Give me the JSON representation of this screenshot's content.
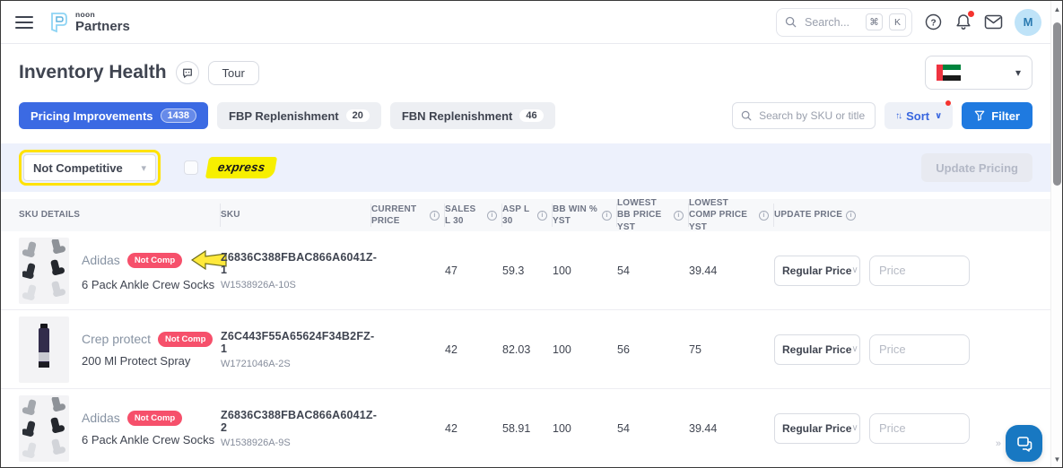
{
  "topbar": {
    "logo": {
      "top": "noon",
      "bottom": "Partners"
    },
    "search_placeholder": "Search...",
    "shortcut_cmd": "⌘",
    "shortcut_k": "K",
    "avatar_initial": "M"
  },
  "page": {
    "title": "Inventory Health",
    "tour_label": "Tour"
  },
  "tabs": [
    {
      "label": "Pricing Improvements",
      "count": "1438"
    },
    {
      "label": "FBP Replenishment",
      "count": "20"
    },
    {
      "label": "FBN Replenishment",
      "count": "46"
    }
  ],
  "toolbar": {
    "search_placeholder": "Search by SKU or title",
    "sort_label": "Sort",
    "filter_label": "Filter"
  },
  "filter_bar": {
    "status_filter": "Not Competitive",
    "express_label": "express",
    "update_pricing_label": "Update Pricing"
  },
  "table": {
    "columns": [
      {
        "label": "SKU DETAILS"
      },
      {
        "label": "SKU"
      },
      {
        "label": "CURRENT PRICE"
      },
      {
        "label": "SALES L 30"
      },
      {
        "label": "ASP L 30"
      },
      {
        "label": "BB WIN % YST"
      },
      {
        "label": "LOWEST BB PRICE YST"
      },
      {
        "label": "LOWEST COMP PRICE YST"
      },
      {
        "label": "UPDATE PRICE"
      }
    ],
    "rows": [
      {
        "brand": "Adidas",
        "badge": "Not Comp",
        "title": "6 Pack Ankle Crew Socks",
        "sku": "Z6836C388FBAC866A6041Z-1",
        "sku_child": "W1538926A-10S",
        "current_price": "",
        "sales_l30": "47",
        "asp_l30": "59.3",
        "bb_win_yst": "100",
        "lowest_bb_price_yst": "54",
        "lowest_comp_price_yst": "39.44",
        "price_type": "Regular Price",
        "price_placeholder": "Price"
      },
      {
        "brand": "Crep protect",
        "badge": "Not Comp",
        "title": "200 Ml Protect Spray",
        "sku": "Z6C443F55A65624F34B2FZ-1",
        "sku_child": "W1721046A-2S",
        "current_price": "",
        "sales_l30": "42",
        "asp_l30": "82.03",
        "bb_win_yst": "100",
        "lowest_bb_price_yst": "56",
        "lowest_comp_price_yst": "75",
        "price_type": "Regular Price",
        "price_placeholder": "Price"
      },
      {
        "brand": "Adidas",
        "badge": "Not Comp",
        "title": "6 Pack Ankle Crew Socks",
        "sku": "Z6836C388FBAC866A6041Z-2",
        "sku_child": "W1538926A-9S",
        "current_price": "",
        "sales_l30": "42",
        "asp_l30": "58.91",
        "bb_win_yst": "100",
        "lowest_bb_price_yst": "54",
        "lowest_comp_price_yst": "39.44",
        "price_type": "Regular Price",
        "price_placeholder": "Price"
      }
    ]
  },
  "glyphs": {
    "caret_down": "▾",
    "chevron_down": "∨",
    "sort_arrows": "↑↓",
    "double_chevron": "»",
    "scroll_up": "▲",
    "scroll_down": "▼"
  },
  "colors": {
    "accent_blue": "#3b6ae3",
    "filter_blue": "#1f7ae0",
    "badge_red": "#f6506b",
    "express_yellow": "#f7ef00",
    "highlight_yellow": "#ffe203",
    "filter_bar_bg": "#edf1fc",
    "avatar_blue": "#bfe3f8",
    "chat_blue": "#1878c2"
  }
}
